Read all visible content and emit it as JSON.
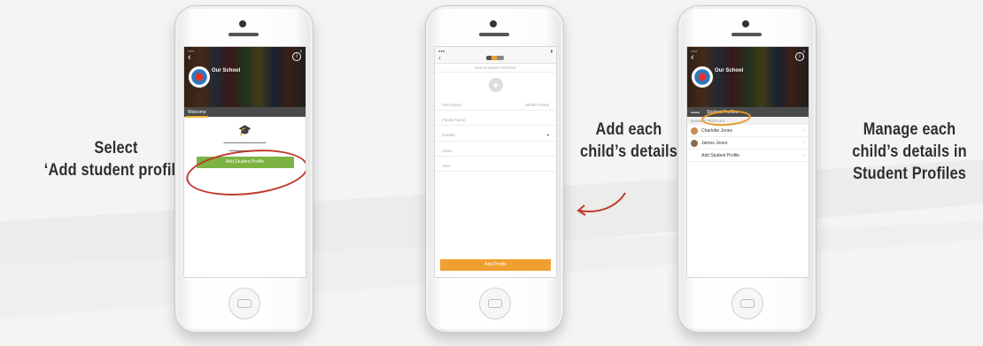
{
  "captions": {
    "select": [
      "Select",
      "‘Add student profile’"
    ],
    "add": [
      "Add each",
      "child’s details"
    ],
    "manage": [
      "Manage each",
      "child’s details in",
      "Student Profiles"
    ]
  },
  "colors": {
    "caption_text": "#2f2f2f",
    "green_button": "#7cb342",
    "orange_button": "#f0a030",
    "highlight_red": "#c0392b",
    "highlight_orange": "#e69a2a",
    "arrow_red": "#c0392b"
  },
  "phone1": {
    "school_name": "Our School",
    "tab_welcome": "Welcome",
    "add_button": "Add Student Profile"
  },
  "phone2": {
    "form_title": "ADD STUDENT PROFILE",
    "fields": {
      "first_name": "First Name",
      "middle_name": "Middle Name",
      "family_name": "Family Name",
      "gender": "Gender",
      "class": "Class",
      "year": "Year"
    },
    "add_profile_button": "Add Profile"
  },
  "phone3": {
    "school_name": "Our School",
    "tab_student_profiles": "Student Profiles",
    "manage_header": "MANAGE PROFILES",
    "profiles": [
      {
        "name": "Charlotte Jones",
        "avatar_color": "#c98a4a"
      },
      {
        "name": "James Jones",
        "avatar_color": "#8a6a4a"
      }
    ],
    "add_student_row": "Add Student Profile"
  },
  "icons": [
    "back-chevron-icon",
    "info-icon",
    "graduation-cap-icon",
    "camera-icon",
    "chevron-right-icon",
    "dropdown-caret-icon"
  ]
}
